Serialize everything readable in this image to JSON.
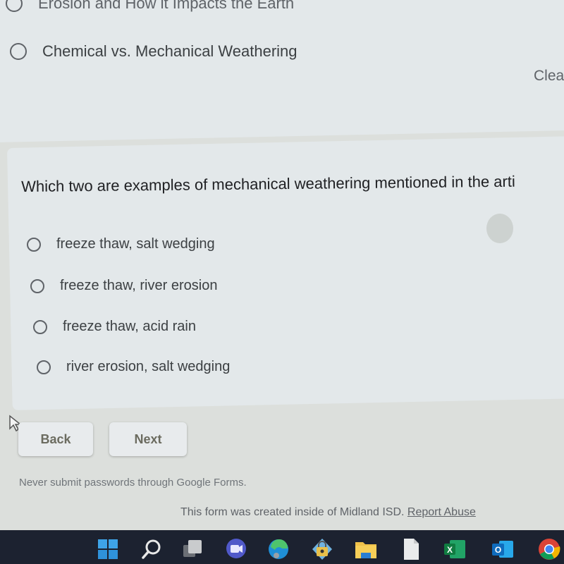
{
  "previous_question": {
    "options": [
      {
        "label": "Erosion and How it Impacts the Earth"
      },
      {
        "label": "Chemical vs. Mechanical Weathering"
      }
    ],
    "clear_label": "Clea"
  },
  "question": {
    "title": "Which two are examples of mechanical weathering mentioned in the arti",
    "options": [
      {
        "label": "freeze thaw, salt wedging"
      },
      {
        "label": "freeze thaw, river erosion"
      },
      {
        "label": "freeze thaw, acid rain"
      },
      {
        "label": "river erosion, salt wedging"
      }
    ]
  },
  "navigation": {
    "back_label": "Back",
    "next_label": "Next"
  },
  "footer": {
    "password_warning": "Never submit passwords through Google Forms.",
    "created_text": "This form was created inside of Midland ISD. ",
    "report_abuse_label": "Report Abuse"
  },
  "taskbar": {
    "icons": [
      "windows-start-icon",
      "search-icon",
      "task-view-icon",
      "teams-meet-icon",
      "edge-icon",
      "security-lock-icon",
      "file-explorer-icon",
      "blank-document-icon",
      "excel-icon",
      "outlook-icon",
      "chrome-icon"
    ],
    "excel_letter": "X",
    "outlook_letter": "O"
  },
  "colors": {
    "card": "#e3e8ea",
    "text": "#3c4043",
    "taskbar": "#1c2230"
  }
}
